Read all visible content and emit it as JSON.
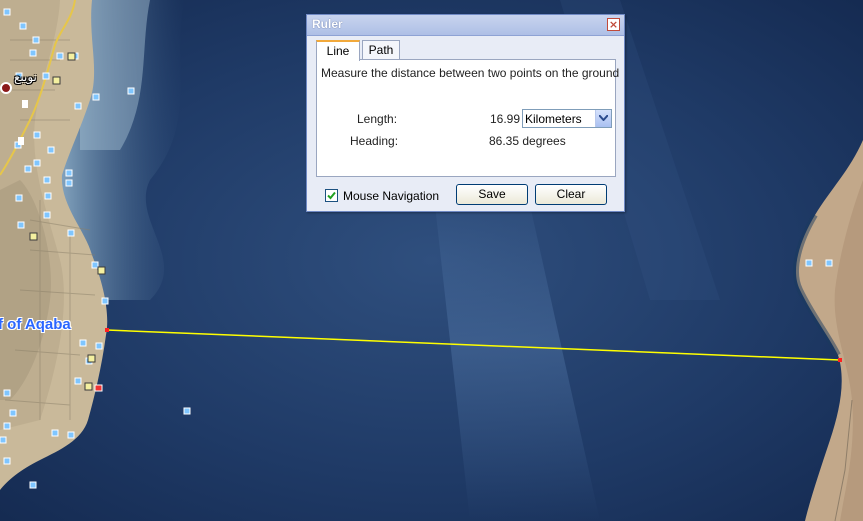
{
  "map": {
    "region_label": "f of Aqaba",
    "place_label": "نويبع",
    "measure_line_color": "#ffff00",
    "endpoint_color": "#ff2020"
  },
  "ruler": {
    "title": "Ruler",
    "close_glyph": "×",
    "tabs": [
      {
        "label": "Line",
        "active": true
      },
      {
        "label": "Path",
        "active": false
      }
    ],
    "instruction": "Measure the distance between two points on the ground",
    "length_label": "Length:",
    "length_value": "16.99",
    "unit_selected": "Kilometers",
    "heading_label": "Heading:",
    "heading_value": "86.35 degrees",
    "mouse_navigation_label": "Mouse Navigation",
    "mouse_navigation_checked": true,
    "save_label": "Save",
    "clear_label": "Clear"
  }
}
